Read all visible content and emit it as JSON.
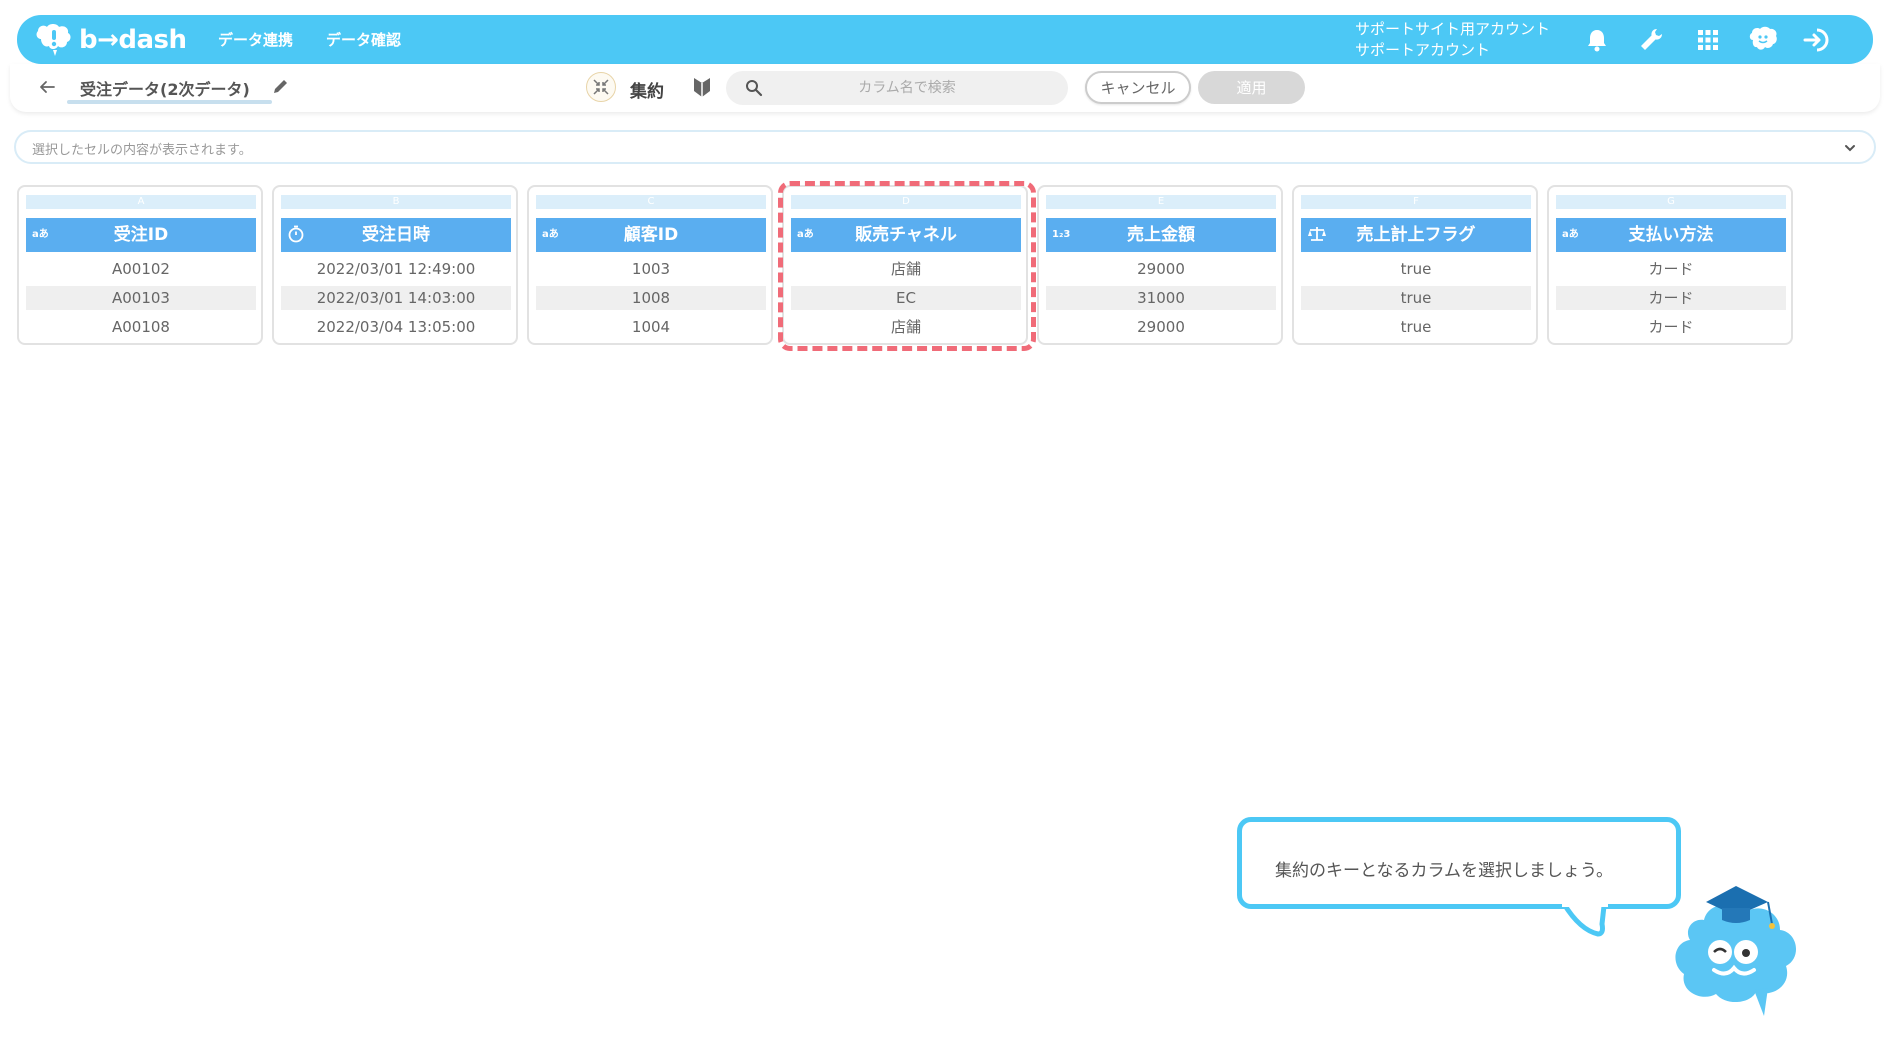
{
  "header": {
    "logo_text": "b→dash",
    "nav": [
      {
        "label": "データ連携"
      },
      {
        "label": "データ確認"
      }
    ],
    "account_line1": "サポートサイト用アカウント",
    "account_line2": "サポートアカウント"
  },
  "toolbar": {
    "table_name": "受注データ(2次データ)",
    "mode_label": "集約",
    "search_placeholder": "カラム名で検索",
    "cancel_label": "キャンセル",
    "apply_label": "適用"
  },
  "cell_bar": {
    "placeholder": "選択したセルの内容が表示されます。"
  },
  "columns": [
    {
      "letter": "A",
      "type": "aあ",
      "name": "受注ID",
      "values": [
        "A00102",
        "A00103",
        "A00108"
      ]
    },
    {
      "letter": "B",
      "type": "datetime-icon",
      "name": "受注日時",
      "values": [
        "2022/03/01 12:49:00",
        "2022/03/01 14:03:00",
        "2022/03/04 13:05:00"
      ]
    },
    {
      "letter": "C",
      "type": "aあ",
      "name": "顧客ID",
      "values": [
        "1003",
        "1008",
        "1004"
      ]
    },
    {
      "letter": "D",
      "type": "aあ",
      "name": "販売チャネル",
      "values": [
        "店舗",
        "EC",
        "店舗"
      ]
    },
    {
      "letter": "E",
      "type": "1₂3",
      "name": "売上金額",
      "values": [
        "29000",
        "31000",
        "29000"
      ]
    },
    {
      "letter": "F",
      "type": "boolean-icon",
      "name": "売上計上フラグ",
      "values": [
        "true",
        "true",
        "true"
      ]
    },
    {
      "letter": "G",
      "type": "aあ",
      "name": "支払い方法",
      "values": [
        "カード",
        "カード",
        "カード"
      ]
    }
  ],
  "guide": {
    "message": "集約のキーとなるカラムを選択しましょう。"
  },
  "colors": {
    "brand": "#4cc8f5",
    "column_header": "#5aaef0",
    "highlight": "#f06b78"
  }
}
